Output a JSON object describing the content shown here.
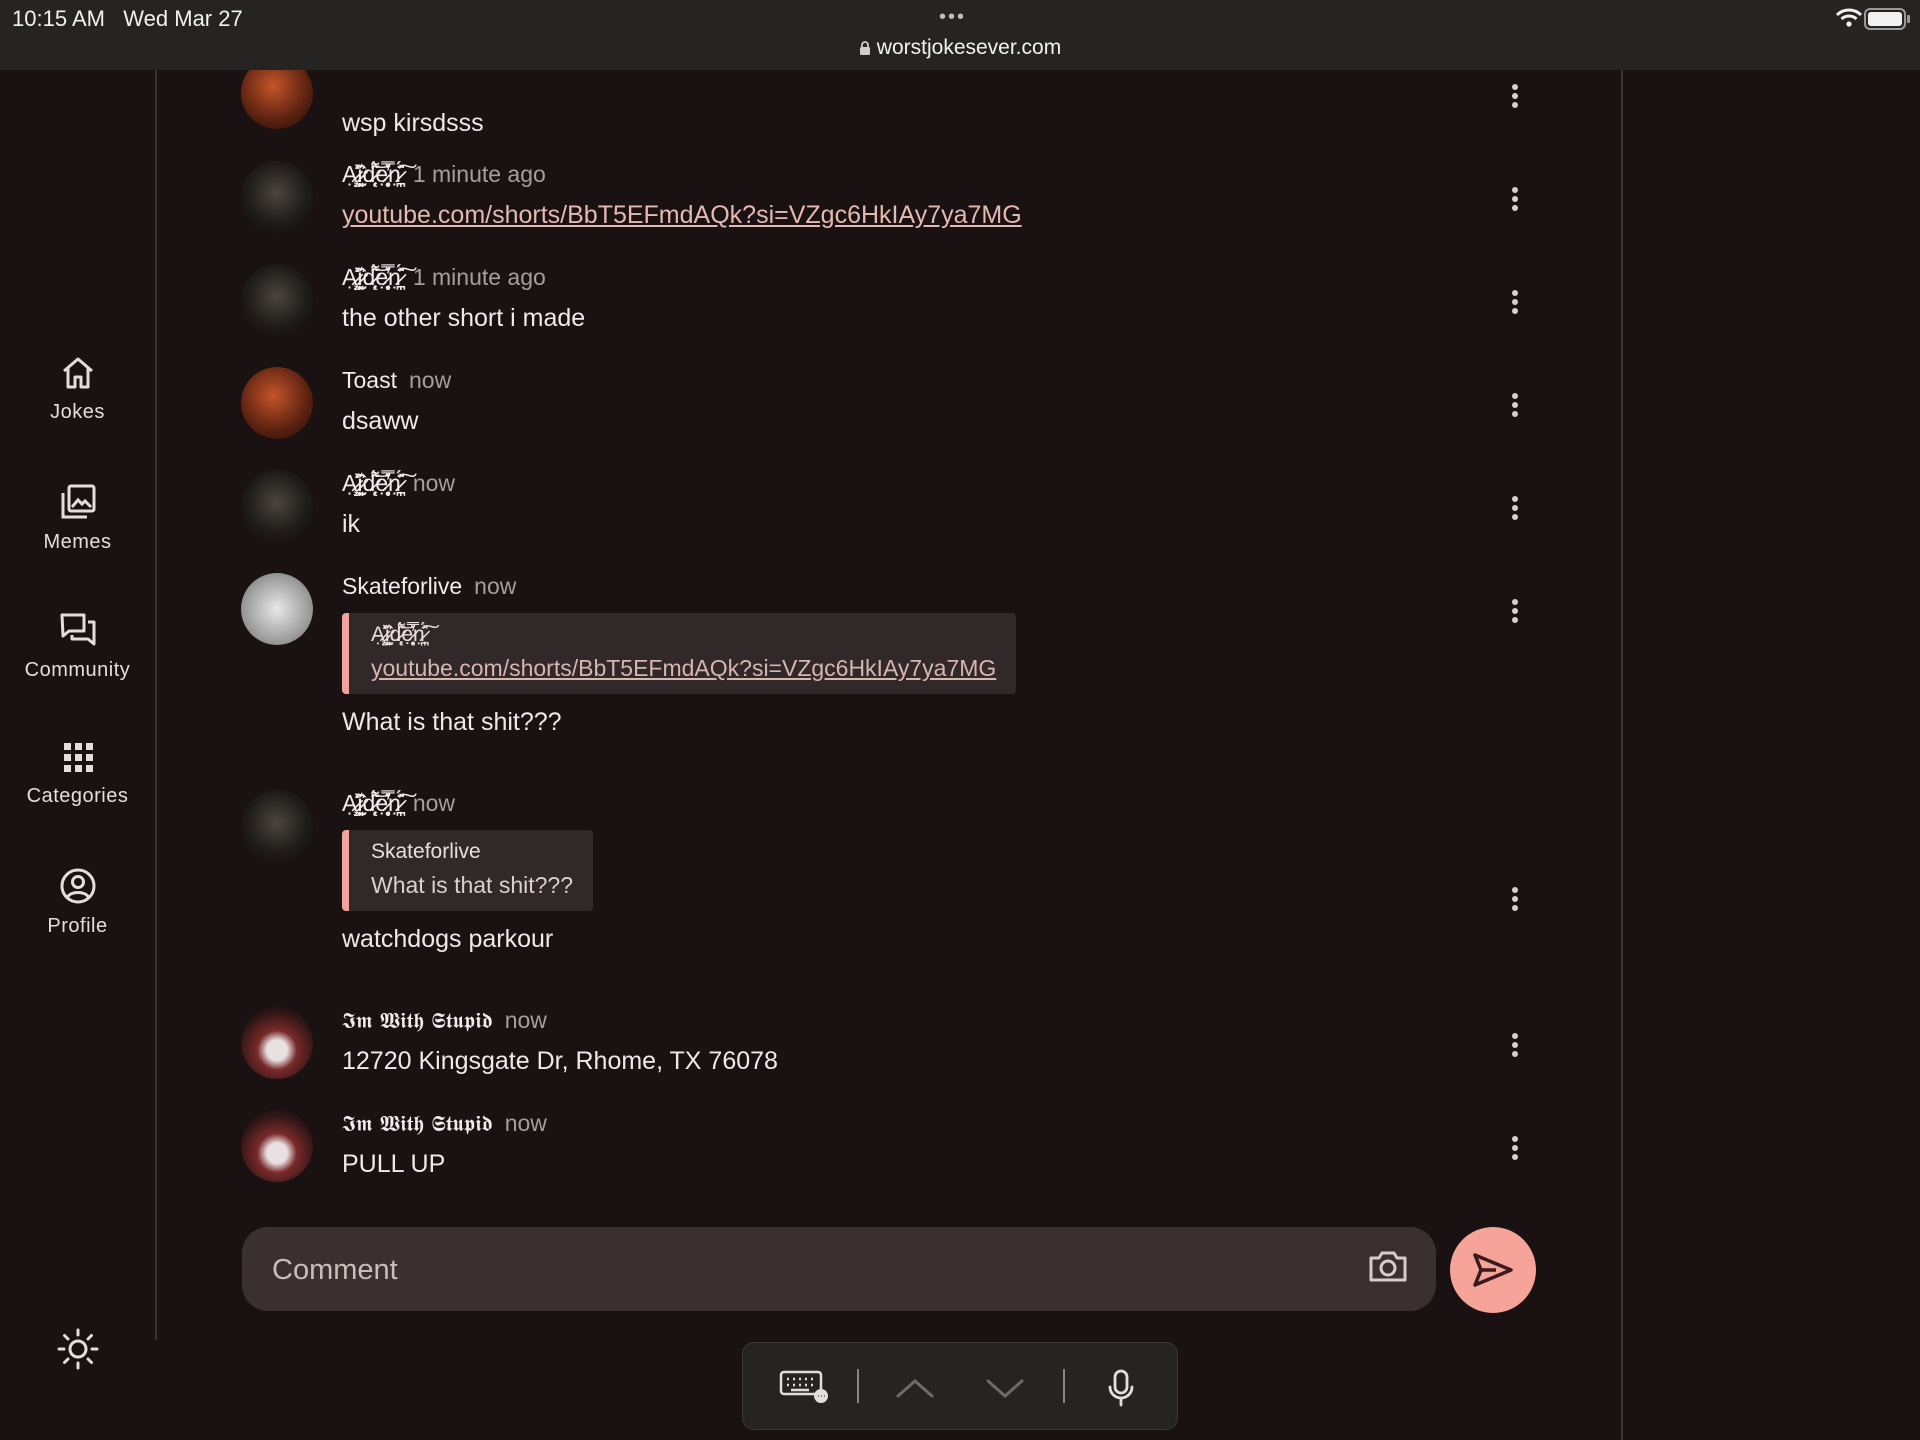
{
  "status_bar": {
    "time": "10:15 AM   Wed Mar 27",
    "dots": "•••",
    "url": "worstjokesever.com"
  },
  "nav": {
    "items": [
      {
        "label": "Jokes",
        "icon": "home-icon"
      },
      {
        "label": "Memes",
        "icon": "image-stack-icon"
      },
      {
        "label": "Community",
        "icon": "chat-bubbles-icon"
      },
      {
        "label": "Categories",
        "icon": "grid-icon"
      },
      {
        "label": "Profile",
        "icon": "user-circle-icon"
      }
    ],
    "theme_icon": "sun-icon"
  },
  "comments": [
    {
      "author": "",
      "time": "",
      "text": "wsp kirsdsss"
    },
    {
      "author": "Ạ̷̧̤͖͗̽̍ị̷͎̮̫̑͛̂d̷̨̜̗̈́͌͝ẹ̷̥̘͎̓̊̿ṇ̷̪͎̩͐̈́͠",
      "time": "1 minute ago",
      "link": "youtube.com/shorts/BbT5EFmdAQk?si=VZgc6HkIAy7ya7MG"
    },
    {
      "author": "Ạ̷̧̤͖͗̽̍ị̷͎̮̫̑͛̂d̷̨̜̗̈́͌͝ẹ̷̥̘͎̓̊̿ṇ̷̪͎̩͐̈́͠",
      "time": "1 minute ago",
      "text": "the other short i made"
    },
    {
      "author": "Toast",
      "time": "now",
      "text": "dsaww"
    },
    {
      "author": "Ạ̷̧̤͖͗̽̍ị̷͎̮̫̑͛̂d̷̨̜̗̈́͌͝ẹ̷̥̘͎̓̊̿ṇ̷̪͎̩͐̈́͠",
      "time": "now",
      "text": "ik"
    },
    {
      "author": "Skateforlive",
      "time": "now",
      "quote": {
        "author": "Ạ̷̧̤͖͗̽̍ị̷͎̮̫̑͛̂d̷̨̜̗̈́͌͝ẹ̷̥̘͎̓̊̿ṇ̷̪͎̩͐̈́͠",
        "link": "youtube.com/shorts/BbT5EFmdAQk?si=VZgc6HkIAy7ya7MG"
      },
      "text": "What is that shit???"
    },
    {
      "author": "Ạ̷̧̤͖͗̽̍ị̷͎̮̫̑͛̂d̷̨̜̗̈́͌͝ẹ̷̥̘͎̓̊̿ṇ̷̪͎̩͐̈́͠",
      "time": "now",
      "quote": {
        "author": "Skateforlive",
        "text": "What is that shit???"
      },
      "text": "watchdogs parkour"
    },
    {
      "author": "𝕴𝖒 𝖂𝖎𝖙𝖍 𝕾𝖙𝖚𝖕𝖎𝖉",
      "time": "now",
      "text": "12720 Kingsgate Dr, Rhome, TX 76078"
    },
    {
      "author": "𝕴𝖒 𝖂𝖎𝖙𝖍 𝕾𝖙𝖚𝖕𝖎𝖉",
      "time": "now",
      "text": "PULL UP"
    }
  ],
  "composer": {
    "placeholder": "Comment",
    "camera_icon": "camera-icon",
    "send_icon": "send-icon",
    "send_color": "#f6a39a"
  },
  "keyboard_bar": {
    "icons": [
      "keyboard-icon",
      "chevron-up-icon",
      "chevron-down-icon",
      "microphone-icon"
    ]
  },
  "colors": {
    "background": "#1a1212",
    "accent": "#f1a39b",
    "muted_text": "#a89d9d"
  }
}
